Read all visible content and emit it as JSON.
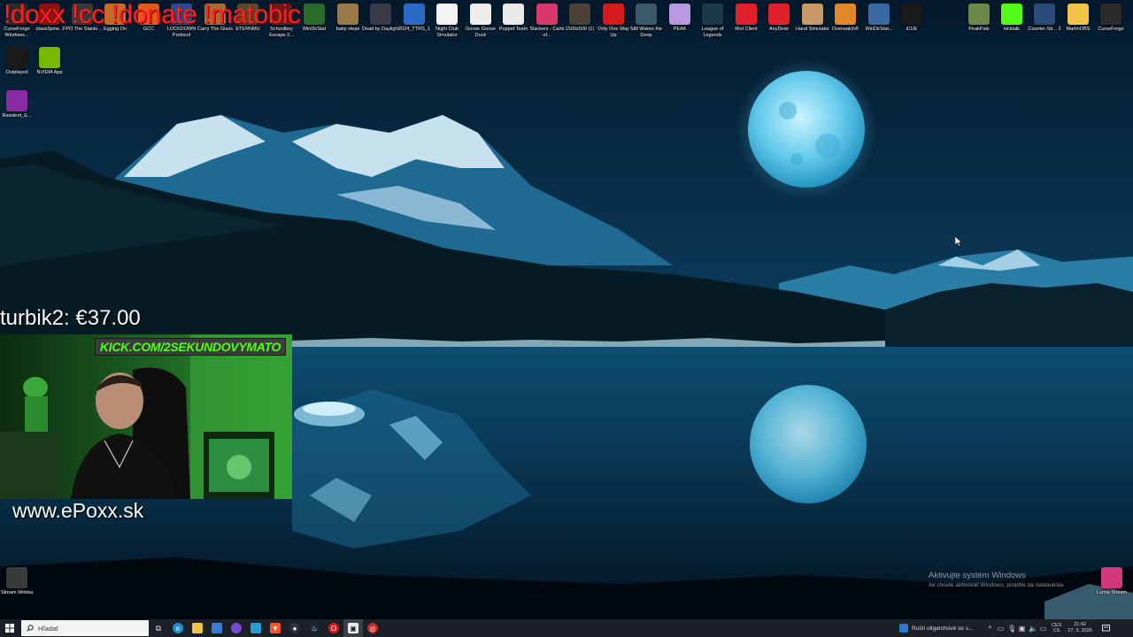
{
  "overlay": {
    "banner": "!doxx !cc !donate !matobic",
    "donation": "turbik2: €37.00",
    "kick": "KICK.COM/2SEKUNDOVYMATO",
    "website": "www.ePoxx.sk"
  },
  "top_icons": [
    {
      "label": "CurseForge Windows...",
      "icon": "curseforge-icon",
      "color": "#2b2b2b"
    },
    {
      "label": "idass3pine...",
      "icon": "app-icon",
      "color": "#8a1212"
    },
    {
      "label": "FPO The Stanle...",
      "icon": "game-icon",
      "color": "#3a3a3a"
    },
    {
      "label": "Egging On",
      "icon": "game-icon",
      "color": "#c46a2a"
    },
    {
      "label": "GCC",
      "icon": "gcc-icon",
      "color": "#e05a1a"
    },
    {
      "label": "LOCKDOWN Protocol",
      "icon": "game-icon",
      "color": "#2d4a8a"
    },
    {
      "label": "Carry The Glass",
      "icon": "game-icon",
      "color": "#a86a34"
    },
    {
      "label": "ETERNMU",
      "icon": "game-icon",
      "color": "#5a4a2a"
    },
    {
      "label": "Schoolboy Escape 2...",
      "icon": "game-icon",
      "color": "#6a1a1a"
    },
    {
      "label": "WinDirStat",
      "icon": "windirstat-icon",
      "color": "#2a6a2a"
    },
    {
      "label": "baby steps",
      "icon": "game-icon",
      "color": "#9a7a4a"
    },
    {
      "label": "Dead by Daylight",
      "icon": "game-icon",
      "color": "#3a3a48"
    },
    {
      "label": "2024_TTRS_1",
      "icon": "file-icon",
      "color": "#2a6ac4"
    },
    {
      "label": "Night Club Simulator",
      "icon": "game-icon",
      "color": "#f3f3f3"
    },
    {
      "label": "Goose Goose Duck",
      "icon": "game-icon",
      "color": "#eeeeee"
    },
    {
      "label": "Puppet Team",
      "icon": "game-icon",
      "color": "#e8e8e8"
    },
    {
      "label": "Slackers - Carts of...",
      "icon": "game-icon",
      "color": "#d8386a"
    },
    {
      "label": "1500x500 (1)",
      "icon": "image-icon",
      "color": "#4a4236"
    },
    {
      "label": "Only One Way Up",
      "icon": "game-icon",
      "color": "#d41a1a"
    },
    {
      "label": "Still Wakes the Deep",
      "icon": "game-icon",
      "color": "#3a5a6a"
    },
    {
      "label": "PEAK",
      "icon": "game-icon",
      "color": "#b898e0"
    },
    {
      "label": "League of Legends",
      "icon": "game-icon",
      "color": "#1a3a4a"
    },
    {
      "label": "Riot Client",
      "icon": "riot-icon",
      "color": "#e0202a"
    },
    {
      "label": "AnyDesk",
      "icon": "anydesk-icon",
      "color": "#e0202a"
    },
    {
      "label": "Hand Simulator",
      "icon": "game-icon",
      "color": "#c89a6a"
    },
    {
      "label": "Overwatch®",
      "icon": "overwatch-icon",
      "color": "#e0882a"
    },
    {
      "label": "WinDirStat...",
      "icon": "windirstat-icon",
      "color": "#3a6aa4"
    },
    {
      "label": "iCUE",
      "icon": "icue-icon",
      "color": "#1a1a1a"
    }
  ],
  "right_icons": [
    {
      "label": "PeakPals",
      "icon": "game-icon",
      "color": "#6a8a4a"
    },
    {
      "label": "kicktalk",
      "icon": "kick-icon",
      "color": "#53fc18"
    },
    {
      "label": "Counter-Str... 2",
      "icon": "cs2-icon",
      "color": "#2a4a7a"
    },
    {
      "label": "MartinOBS",
      "icon": "folder-icon",
      "color": "#f0c44a"
    },
    {
      "label": "CurseForge",
      "icon": "curseforge-icon",
      "color": "#2b2b2b"
    }
  ],
  "left_icons": [
    {
      "label": "Outplayed",
      "icon": "outplayed-icon",
      "color": "#1a1a1a"
    },
    {
      "label": "NVIDIA App",
      "icon": "nvidia-icon",
      "color": "#76b900"
    },
    {
      "label": "Resident_E...",
      "icon": "archive-icon",
      "color": "#8a2aa4"
    }
  ],
  "bottom_icons": [
    {
      "label": "Stream Webka",
      "icon": "file-icon",
      "color": "#3a3a3a"
    },
    {
      "label": "Lumia Stream",
      "icon": "lumia-icon",
      "color": "#d4387a"
    }
  ],
  "watermark": {
    "title": "Aktivujte systém Windows",
    "subtitle": "Ak chcete aktivovať Windows, prejdite na nastavenia."
  },
  "taskbar": {
    "search_placeholder": "Hľadať",
    "news": "Ruští oligarchové se s...",
    "lang_top": "CES",
    "lang_bottom": "CS",
    "time": "21:42",
    "date": "27. 3. 2026"
  }
}
